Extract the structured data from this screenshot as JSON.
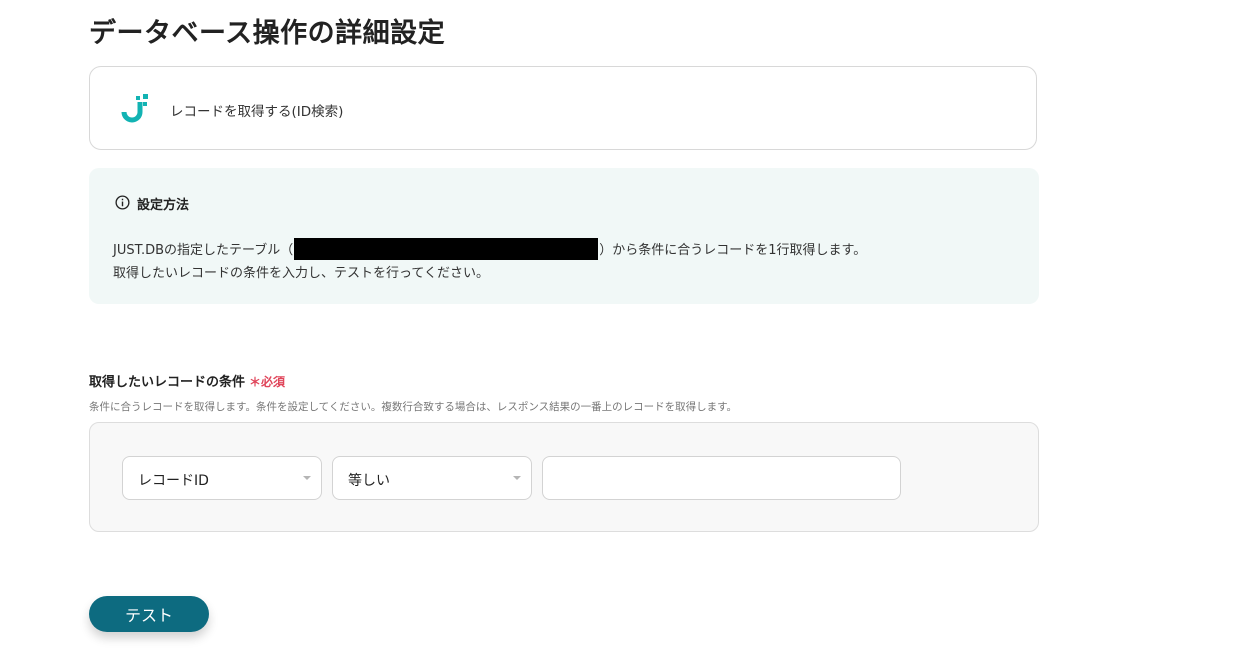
{
  "page": {
    "title": "データベース操作の詳細設定"
  },
  "action": {
    "icon": "just-db-logo-icon",
    "label": "レコードを取得する(ID検索)"
  },
  "info": {
    "icon": "info-icon",
    "title": "設定方法",
    "line1_prefix": "JUST.DBの指定したテーブル（",
    "line1_suffix": "）から条件に合うレコードを1行取得します。",
    "line2": "取得したいレコードの条件を入力し、テストを行ってください。"
  },
  "condition": {
    "label": "取得したいレコードの条件",
    "required_mark": "＊",
    "required_text": "必須",
    "help": "条件に合うレコードを取得します。条件を設定してください。複数行合致する場合は、レスポンス結果の一番上のレコードを取得します。",
    "field_select": {
      "selected": "レコードID"
    },
    "operator_select": {
      "selected": "等しい"
    },
    "value_input": {
      "value": "",
      "placeholder": ""
    }
  },
  "buttons": {
    "test_label": "テスト"
  },
  "colors": {
    "primary_button": "#0d6b80",
    "info_background": "#f1f8f7",
    "required": "#e0455a",
    "brand_teal": "#12b3b3"
  }
}
